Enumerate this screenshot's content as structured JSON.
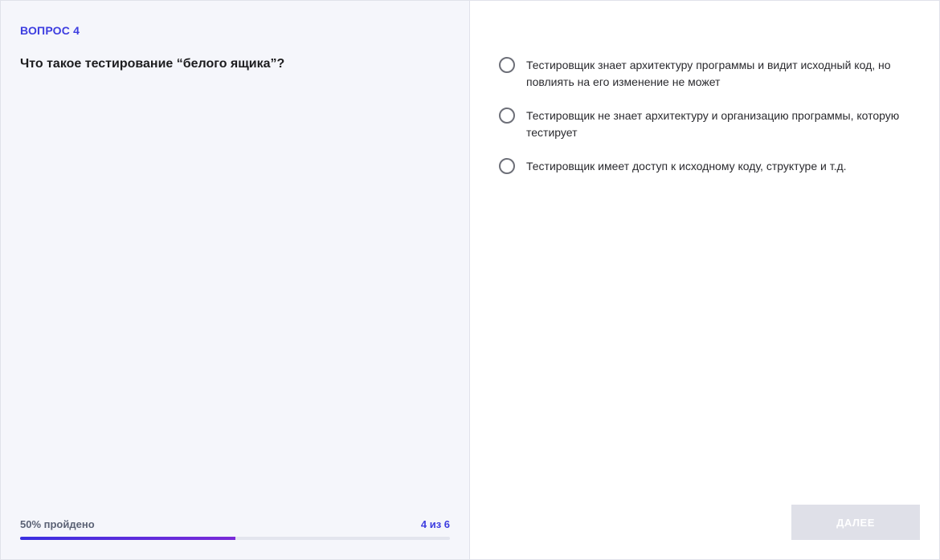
{
  "question": {
    "number_label": "ВОПРОС 4",
    "text": "Что такое тестирование “белого ящика”?"
  },
  "progress": {
    "label": "50% пройдено",
    "count": "4 из 6",
    "percent": 50
  },
  "options": [
    {
      "text": "Тестировщик знает архитектуру программы и видит исходный код, но повлиять на его изменение не может",
      "selected": false
    },
    {
      "text": "Тестировщик не знает архитектуру и организацию программы, которую тестирует",
      "selected": false
    },
    {
      "text": "Тестировщик имеет доступ к исходному коду, структуре и т.д.",
      "selected": false
    }
  ],
  "next_button": {
    "label": "ДАЛЕЕ",
    "enabled": false
  },
  "colors": {
    "accent": "#3d3de0",
    "panel_bg": "#f5f6fb",
    "button_disabled": "#dfe0e8"
  }
}
